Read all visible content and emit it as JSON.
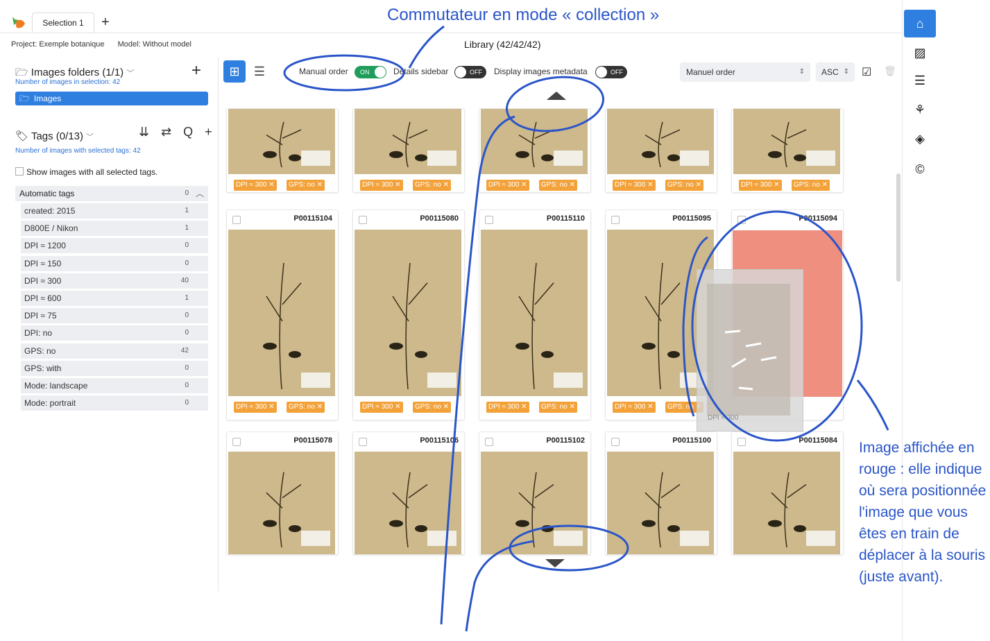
{
  "tabs": {
    "active_label": "Selection 1",
    "add_label": "+"
  },
  "project": {
    "project_label": "Project: Exemple botanique",
    "model_label": "Model: Without model"
  },
  "library": {
    "title": "Library (42/42/42)"
  },
  "folders": {
    "title": "Images folders (1/1)",
    "subtitle": "Number of images in selection: 42",
    "add_label": "+",
    "item_label": "Images"
  },
  "tags": {
    "title": "Tags (0/13)",
    "subtitle": "Number of images with selected tags: 42",
    "tools": "⇊ ⇄ Q +",
    "show_all_label": "Show images with all selected tags.",
    "group": {
      "label": "Automatic tags",
      "count": "0"
    },
    "items": [
      {
        "label": "created: 2015",
        "count": "1"
      },
      {
        "label": "D800E / Nikon",
        "count": "1"
      },
      {
        "label": "DPI ≈ 1200",
        "count": "0"
      },
      {
        "label": "DPI ≈ 150",
        "count": "0"
      },
      {
        "label": "DPI ≈ 300",
        "count": "40"
      },
      {
        "label": "DPI ≈ 600",
        "count": "1"
      },
      {
        "label": "DPI ≈ 75",
        "count": "0"
      },
      {
        "label": "DPI: no",
        "count": "0"
      },
      {
        "label": "GPS: no",
        "count": "42"
      },
      {
        "label": "GPS: with",
        "count": "0"
      },
      {
        "label": "Mode: landscape",
        "count": "0"
      },
      {
        "label": "Mode: portrait",
        "count": "0"
      }
    ]
  },
  "toolbar": {
    "manual_order_label": "Manual order",
    "manual_order_state": "ON",
    "details_label": "Details sidebar",
    "details_state": "OFF",
    "metadata_label": "Display images metadata",
    "metadata_state": "OFF",
    "sort_value": "Manuel order",
    "dir_value": "ASC"
  },
  "badges": {
    "dpi": "DPI ≈ 300 ✕",
    "gps": "GPS: no ✕",
    "ghost": "DPI ≈ 300"
  },
  "rows": {
    "row2": [
      "P00115104",
      "P00115080",
      "P00115110",
      "P00115095",
      "P00115094"
    ],
    "row3": [
      "P00115078",
      "P00115106",
      "P00115102",
      "P00115100",
      "P00115084"
    ]
  },
  "annotations": {
    "top": "Commutateur en mode « collection »",
    "right": "Image affichée en rouge : elle indique où sera positionnée l'image que vous êtes en train de déplacer à la souris (juste avant)."
  },
  "colors": {
    "accent": "#2f7fe0",
    "badge": "#f3a23a",
    "on": "#1f9d5a",
    "annotation": "#2a55c8",
    "drop_target": "#ee8f80",
    "sheet": "#cdb98c"
  },
  "icons": {
    "sidebar": [
      "home-icon",
      "image-icon",
      "list-icon",
      "hierarchy-icon",
      "layers-icon",
      "copyright-icon"
    ]
  }
}
